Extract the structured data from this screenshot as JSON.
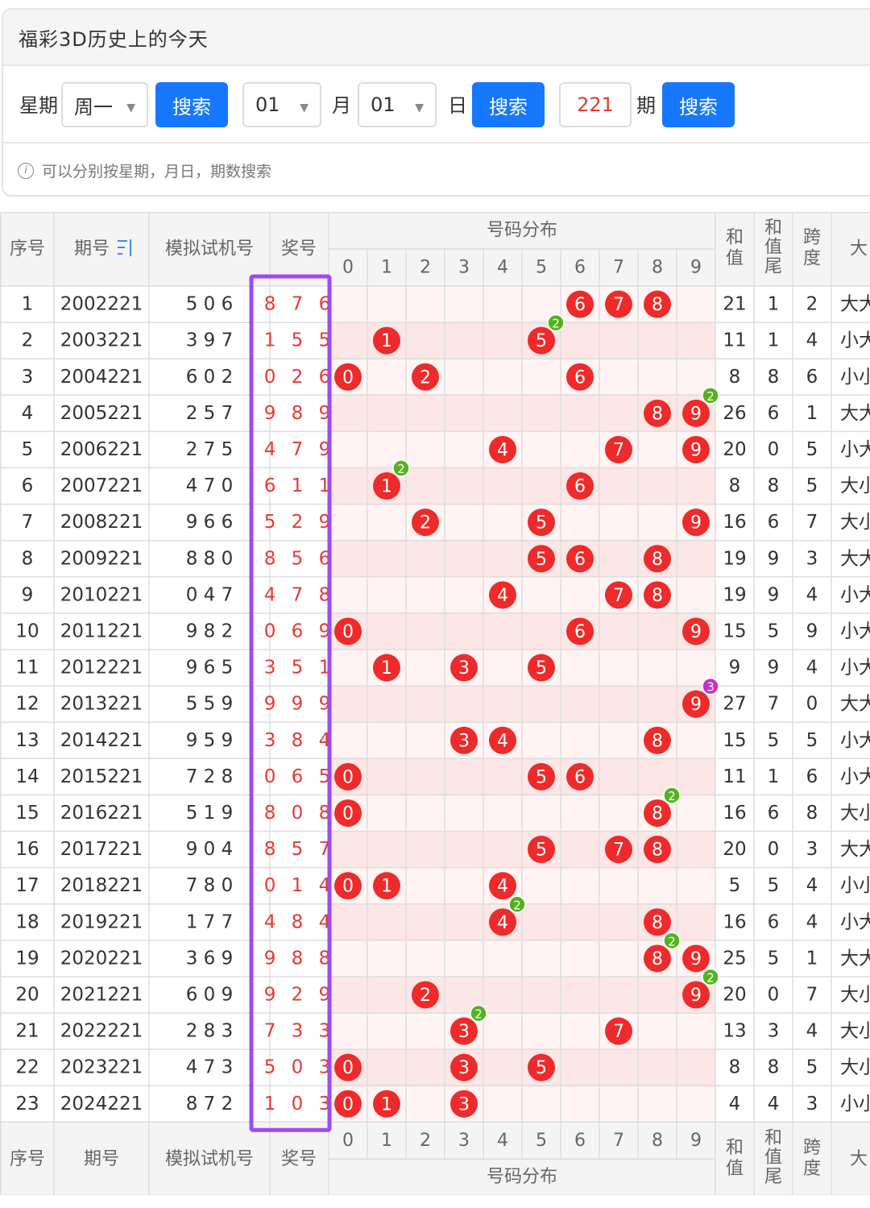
{
  "header": {
    "title": "福彩3D历史上的今天"
  },
  "search": {
    "week_label": "星期",
    "week_value": "周一",
    "month_value": "01",
    "month_label": "月",
    "day_value": "01",
    "day_label": "日",
    "issue_value": "221",
    "issue_label": "期",
    "search_label": "搜索",
    "hint": "可以分别按星期，月日，期数搜索"
  },
  "table": {
    "headers": {
      "index": "序号",
      "issue": "期号",
      "sort_icon": "sort-icon",
      "sim": "模拟试机号",
      "award": "奖号",
      "dist": "号码分布",
      "sum": "和值",
      "sum_tail": "和值尾",
      "span": "跨度",
      "big": "大"
    },
    "digits": [
      "0",
      "1",
      "2",
      "3",
      "4",
      "5",
      "6",
      "7",
      "8",
      "9"
    ],
    "rows": [
      {
        "idx": "1",
        "issue": "2002221",
        "sim": "5 0 6",
        "award": "8 7 6",
        "sum": "21",
        "tail": "1",
        "span": "2",
        "big": "大大",
        "balls": [
          {
            "d": 6
          },
          {
            "d": 7
          },
          {
            "d": 8
          }
        ]
      },
      {
        "idx": "2",
        "issue": "2003221",
        "sim": "3 9 7",
        "award": "1 5 5",
        "sum": "11",
        "tail": "1",
        "span": "4",
        "big": "小大",
        "balls": [
          {
            "d": 1
          },
          {
            "d": 5,
            "badge": "2"
          }
        ]
      },
      {
        "idx": "3",
        "issue": "2004221",
        "sim": "6 0 2",
        "award": "0 2 6",
        "sum": "8",
        "tail": "8",
        "span": "6",
        "big": "小小",
        "balls": [
          {
            "d": 0
          },
          {
            "d": 2
          },
          {
            "d": 6
          }
        ]
      },
      {
        "idx": "4",
        "issue": "2005221",
        "sim": "2 5 7",
        "award": "9 8 9",
        "sum": "26",
        "tail": "6",
        "span": "1",
        "big": "大大",
        "balls": [
          {
            "d": 8
          },
          {
            "d": 9,
            "badge": "2"
          }
        ]
      },
      {
        "idx": "5",
        "issue": "2006221",
        "sim": "2 7 5",
        "award": "4 7 9",
        "sum": "20",
        "tail": "0",
        "span": "5",
        "big": "小大",
        "balls": [
          {
            "d": 4
          },
          {
            "d": 7
          },
          {
            "d": 9
          }
        ]
      },
      {
        "idx": "6",
        "issue": "2007221",
        "sim": "4 7 0",
        "award": "6 1 1",
        "sum": "8",
        "tail": "8",
        "span": "5",
        "big": "大小",
        "balls": [
          {
            "d": 1,
            "badge": "2"
          },
          {
            "d": 6
          }
        ]
      },
      {
        "idx": "7",
        "issue": "2008221",
        "sim": "9 6 6",
        "award": "5 2 9",
        "sum": "16",
        "tail": "6",
        "span": "7",
        "big": "大小",
        "balls": [
          {
            "d": 2
          },
          {
            "d": 5
          },
          {
            "d": 9
          }
        ]
      },
      {
        "idx": "8",
        "issue": "2009221",
        "sim": "8 8 0",
        "award": "8 5 6",
        "sum": "19",
        "tail": "9",
        "span": "3",
        "big": "大大",
        "balls": [
          {
            "d": 5
          },
          {
            "d": 6
          },
          {
            "d": 8
          }
        ]
      },
      {
        "idx": "9",
        "issue": "2010221",
        "sim": "0 4 7",
        "award": "4 7 8",
        "sum": "19",
        "tail": "9",
        "span": "4",
        "big": "小大",
        "balls": [
          {
            "d": 4
          },
          {
            "d": 7
          },
          {
            "d": 8
          }
        ]
      },
      {
        "idx": "10",
        "issue": "2011221",
        "sim": "9 8 2",
        "award": "0 6 9",
        "sum": "15",
        "tail": "5",
        "span": "9",
        "big": "小大",
        "balls": [
          {
            "d": 0
          },
          {
            "d": 6
          },
          {
            "d": 9
          }
        ]
      },
      {
        "idx": "11",
        "issue": "2012221",
        "sim": "9 6 5",
        "award": "3 5 1",
        "sum": "9",
        "tail": "9",
        "span": "4",
        "big": "小大",
        "balls": [
          {
            "d": 1
          },
          {
            "d": 3
          },
          {
            "d": 5
          }
        ]
      },
      {
        "idx": "12",
        "issue": "2013221",
        "sim": "5 5 9",
        "award": "9 9 9",
        "sum": "27",
        "tail": "7",
        "span": "0",
        "big": "大大",
        "balls": [
          {
            "d": 9,
            "badge": "3",
            "purple": true
          }
        ]
      },
      {
        "idx": "13",
        "issue": "2014221",
        "sim": "9 5 9",
        "award": "3 8 4",
        "sum": "15",
        "tail": "5",
        "span": "5",
        "big": "小大",
        "balls": [
          {
            "d": 3
          },
          {
            "d": 4
          },
          {
            "d": 8
          }
        ]
      },
      {
        "idx": "14",
        "issue": "2015221",
        "sim": "7 2 8",
        "award": "0 6 5",
        "sum": "11",
        "tail": "1",
        "span": "6",
        "big": "小大",
        "balls": [
          {
            "d": 0
          },
          {
            "d": 5
          },
          {
            "d": 6
          }
        ]
      },
      {
        "idx": "15",
        "issue": "2016221",
        "sim": "5 1 9",
        "award": "8 0 8",
        "sum": "16",
        "tail": "6",
        "span": "8",
        "big": "大小",
        "balls": [
          {
            "d": 0
          },
          {
            "d": 8,
            "badge": "2"
          }
        ]
      },
      {
        "idx": "16",
        "issue": "2017221",
        "sim": "9 0 4",
        "award": "8 5 7",
        "sum": "20",
        "tail": "0",
        "span": "3",
        "big": "大大",
        "balls": [
          {
            "d": 5
          },
          {
            "d": 7
          },
          {
            "d": 8
          }
        ]
      },
      {
        "idx": "17",
        "issue": "2018221",
        "sim": "7 8 0",
        "award": "0 1 4",
        "sum": "5",
        "tail": "5",
        "span": "4",
        "big": "小小",
        "balls": [
          {
            "d": 0
          },
          {
            "d": 1
          },
          {
            "d": 4
          }
        ]
      },
      {
        "idx": "18",
        "issue": "2019221",
        "sim": "1 7 7",
        "award": "4 8 4",
        "sum": "16",
        "tail": "6",
        "span": "4",
        "big": "小大",
        "balls": [
          {
            "d": 4,
            "badge": "2"
          },
          {
            "d": 8
          }
        ]
      },
      {
        "idx": "19",
        "issue": "2020221",
        "sim": "3 6 9",
        "award": "9 8 8",
        "sum": "25",
        "tail": "5",
        "span": "1",
        "big": "大大",
        "balls": [
          {
            "d": 8,
            "badge": "2"
          },
          {
            "d": 9
          }
        ]
      },
      {
        "idx": "20",
        "issue": "2021221",
        "sim": "6 0 9",
        "award": "9 2 9",
        "sum": "20",
        "tail": "0",
        "span": "7",
        "big": "大小",
        "balls": [
          {
            "d": 2
          },
          {
            "d": 9,
            "badge": "2"
          }
        ]
      },
      {
        "idx": "21",
        "issue": "2022221",
        "sim": "2 8 3",
        "award": "7 3 3",
        "sum": "13",
        "tail": "3",
        "span": "4",
        "big": "大小",
        "balls": [
          {
            "d": 3,
            "badge": "2"
          },
          {
            "d": 7
          }
        ]
      },
      {
        "idx": "22",
        "issue": "2023221",
        "sim": "4 7 3",
        "award": "5 0 3",
        "sum": "8",
        "tail": "8",
        "span": "5",
        "big": "大小",
        "balls": [
          {
            "d": 0
          },
          {
            "d": 3
          },
          {
            "d": 5
          }
        ]
      },
      {
        "idx": "23",
        "issue": "2024221",
        "sim": "8 7 2",
        "award": "1 0 3",
        "sum": "4",
        "tail": "4",
        "span": "3",
        "big": "小小",
        "balls": [
          {
            "d": 0
          },
          {
            "d": 1
          },
          {
            "d": 3
          }
        ]
      }
    ]
  },
  "colors": {
    "ball": "#ee2a2a",
    "badge_green": "#52b31f",
    "badge_purple": "#c62ed0",
    "highlight_box": "#9d4cf0",
    "link_blue": "#3a8ee6",
    "dist_band": "#fdecec"
  }
}
